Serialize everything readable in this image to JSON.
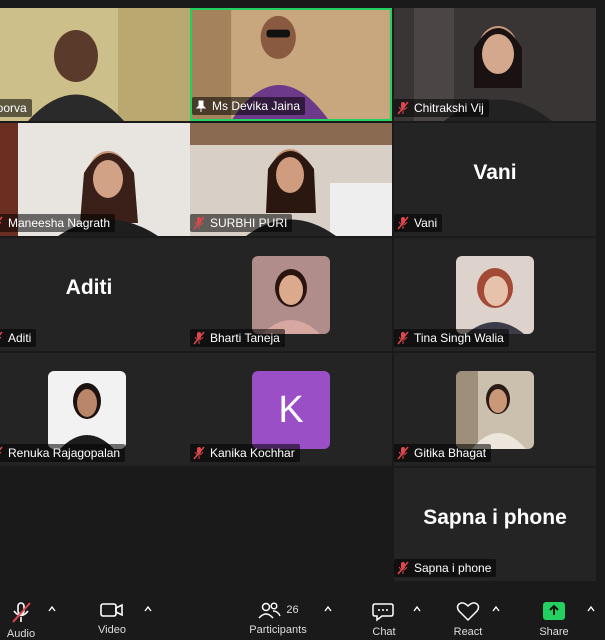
{
  "participants": [
    {
      "name": "Apoorva",
      "display": "poorva",
      "type": "video"
    },
    {
      "name": "Ms Devika Jaina",
      "type": "video",
      "active": true,
      "pinned": true
    },
    {
      "name": "Chitrakshi Vij",
      "type": "video",
      "muted": true
    },
    {
      "name": "Maneesha Nagrath",
      "type": "video",
      "muted": true
    },
    {
      "name": "SURBHI PURI",
      "type": "video",
      "muted": true
    },
    {
      "name": "Vani",
      "type": "name",
      "muted": true
    },
    {
      "name": "Aditi",
      "type": "name",
      "muted": true
    },
    {
      "name": "Bharti Taneja",
      "type": "photo",
      "muted": true
    },
    {
      "name": "Tina Singh Walia",
      "type": "photo",
      "muted": true
    },
    {
      "name": "Renuka Rajagopalan",
      "type": "photo",
      "muted": true
    },
    {
      "name": "Kanika Kochhar",
      "type": "letter",
      "letter": "K",
      "muted": true
    },
    {
      "name": "Gitika Bhagat",
      "type": "photo",
      "muted": true
    },
    {
      "name": "Sapna i phone",
      "type": "name",
      "muted": true
    }
  ],
  "toolbar": {
    "audio_label": "Audio",
    "video_label": "Video",
    "participants_label": "Participants",
    "participants_count": "26",
    "chat_label": "Chat",
    "react_label": "React",
    "share_label": "Share"
  },
  "colors": {
    "active_border": "#23d160",
    "muted_icon": "#e0474c",
    "share_green": "#23d160",
    "avatar_purple": "#9b4fc7"
  }
}
